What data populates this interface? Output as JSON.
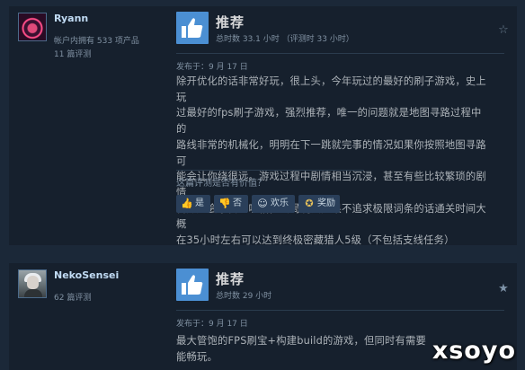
{
  "reviews": [
    {
      "author": {
        "name": "Ryann",
        "products_owned": "帐户内拥有 533 项产品",
        "review_count": "11 篇评测"
      },
      "verdict": "推荐",
      "hours": "总时数 33.1 小时   （评测时 33 小时）",
      "posted": "发布于：9 月 17 日",
      "body_lines": [
        "除开优化的话非常好玩，很上头，今年玩过的最好的刷子游戏，史上玩",
        "过最好的fps刷子游戏，强烈推荐，唯一的问题就是地图寻路过程中的",
        "路线非常的机械化，明明在下一跳就完事的情况如果你按照地图寻路可",
        "能会让你绕很远。游戏过程中剧情相当沉浸，甚至有些比较繁琐的剧情",
        "官方还会亲自的吐槽，终局玩法如果不追求极限词条的话通关时间大概",
        "在35小时左右可以达到终极密藏猎人5级（不包括支线任务）"
      ],
      "helpful_question": "这篇评测是否有价值？",
      "votes": {
        "yes": "是",
        "no": "否",
        "funny": "欢乐",
        "award": "奖励"
      }
    },
    {
      "author": {
        "name": "NekoSensei",
        "review_count": "62 篇评测"
      },
      "verdict": "推荐",
      "hours": "总时数 29 小时",
      "posted": "发布于：9 月 17 日",
      "body_lines": [
        "最大管饱的FPS刷宝+构建build的游戏，但同时有需要",
        "能畅玩。"
      ]
    }
  ],
  "watermark": "xsoyo",
  "icons": {
    "thumbs_up": "thumbs-up-icon",
    "thumbs_down": "thumbs-down-icon",
    "funny": "smiley-icon",
    "award": "award-icon",
    "star": "star-icon"
  },
  "colors": {
    "page_bg": "#1b2838",
    "card_bg": "#16202d",
    "thumb_bg": "#4b8fd3",
    "name": "#c1dbf4",
    "body_text": "#acb2b8"
  }
}
